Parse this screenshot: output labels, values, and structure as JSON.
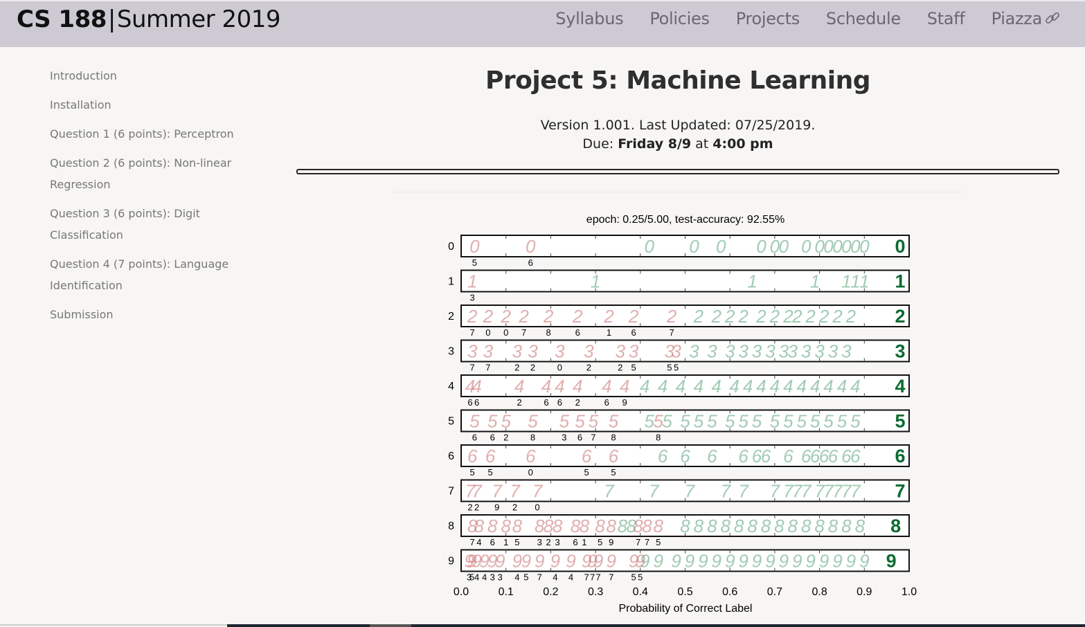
{
  "navbar": {
    "course": "CS 188",
    "separator": "|",
    "term": "Summer 2019",
    "links": [
      {
        "label": "Syllabus"
      },
      {
        "label": "Policies"
      },
      {
        "label": "Projects"
      },
      {
        "label": "Schedule"
      },
      {
        "label": "Staff"
      },
      {
        "label": "Piazza",
        "icon": "external-link-icon"
      }
    ]
  },
  "sidebar": {
    "items": [
      {
        "label": "Introduction"
      },
      {
        "label": "Installation"
      },
      {
        "label": "Question 1 (6 points): Perceptron"
      },
      {
        "label": "Question 2 (6 points): Non-linear Regression"
      },
      {
        "label": "Question 3 (6 points): Digit Classification"
      },
      {
        "label": "Question 4 (7 points): Language Identification"
      },
      {
        "label": "Submission"
      }
    ]
  },
  "page": {
    "title": "Project 5: Machine Learning",
    "version_line": "Version 1.001. Last Updated: 07/25/2019.",
    "due_prefix": "Due: ",
    "due_day": "Friday 8/9",
    "due_mid": " at ",
    "due_time": "4:00 pm"
  },
  "colors": {
    "navbar_bg": "#cdcad4",
    "page_bg": "#f7f6f4",
    "correct": "#2e8b57",
    "incorrect": "#c96b6b"
  },
  "chart_data": {
    "type": "scatter",
    "title": "epoch: 0.25/5.00, test-accuracy: 92.55%",
    "xlabel": "Probability of Correct Label",
    "ylabel": "",
    "xlim": [
      0.0,
      1.0
    ],
    "xticks": [
      "0.0",
      "0.1",
      "0.2",
      "0.3",
      "0.4",
      "0.5",
      "0.6",
      "0.7",
      "0.8",
      "0.9",
      "1.0"
    ],
    "categories": [
      "0",
      "1",
      "2",
      "3",
      "4",
      "5",
      "6",
      "7",
      "8",
      "9"
    ],
    "grid": false,
    "legend": "none",
    "series": [
      {
        "name": "0",
        "misclassified": [
          {
            "p": 0.03,
            "pred": "5"
          },
          {
            "p": 0.155,
            "pred": "6"
          }
        ],
        "correct_p": [
          0.42,
          0.52,
          0.58,
          0.67,
          0.7,
          0.72,
          0.77,
          0.8,
          0.82,
          0.84,
          0.86,
          0.88,
          0.9
        ],
        "best_p": 0.98
      },
      {
        "name": "1",
        "misclassified": [
          {
            "p": 0.025,
            "pred": "3"
          }
        ],
        "correct_p": [
          0.3,
          0.65,
          0.79,
          0.86,
          0.88,
          0.9
        ],
        "best_p": 0.98
      },
      {
        "name": "2",
        "misclassified": [
          {
            "p": 0.025,
            "pred": "7"
          },
          {
            "p": 0.06,
            "pred": "0"
          },
          {
            "p": 0.1,
            "pred": "0"
          },
          {
            "p": 0.14,
            "pred": "7"
          },
          {
            "p": 0.195,
            "pred": "8"
          },
          {
            "p": 0.26,
            "pred": "6"
          },
          {
            "p": 0.33,
            "pred": "1"
          },
          {
            "p": 0.385,
            "pred": "6"
          },
          {
            "p": 0.47,
            "pred": "7"
          }
        ],
        "correct_p": [
          0.53,
          0.57,
          0.6,
          0.63,
          0.67,
          0.7,
          0.73,
          0.75,
          0.78,
          0.81,
          0.84,
          0.87
        ],
        "best_p": 0.98
      },
      {
        "name": "3",
        "misclassified": [
          {
            "p": 0.025,
            "pred": "7"
          },
          {
            "p": 0.06,
            "pred": "7"
          },
          {
            "p": 0.125,
            "pred": "2"
          },
          {
            "p": 0.16,
            "pred": "2"
          },
          {
            "p": 0.22,
            "pred": "0"
          },
          {
            "p": 0.285,
            "pred": "2"
          },
          {
            "p": 0.355,
            "pred": "2"
          },
          {
            "p": 0.385,
            "pred": "5"
          },
          {
            "p": 0.465,
            "pred": "5"
          },
          {
            "p": 0.48,
            "pred": "5"
          }
        ],
        "correct_p": [
          0.52,
          0.56,
          0.6,
          0.63,
          0.66,
          0.69,
          0.72,
          0.74,
          0.77,
          0.8,
          0.83,
          0.86
        ],
        "best_p": 0.98
      },
      {
        "name": "4",
        "misclassified": [
          {
            "p": 0.02,
            "pred": "6"
          },
          {
            "p": 0.035,
            "pred": "6"
          },
          {
            "p": 0.13,
            "pred": "2"
          },
          {
            "p": 0.19,
            "pred": "6"
          },
          {
            "p": 0.22,
            "pred": "6"
          },
          {
            "p": 0.26,
            "pred": "2"
          },
          {
            "p": 0.325,
            "pred": "6"
          },
          {
            "p": 0.365,
            "pred": "9"
          }
        ],
        "correct_p": [
          0.41,
          0.45,
          0.49,
          0.53,
          0.57,
          0.61,
          0.64,
          0.67,
          0.7,
          0.73,
          0.76,
          0.79,
          0.82,
          0.85,
          0.88
        ],
        "best_p": 0.98
      },
      {
        "name": "5",
        "misclassified": [
          {
            "p": 0.03,
            "pred": "6"
          },
          {
            "p": 0.07,
            "pred": "6"
          },
          {
            "p": 0.1,
            "pred": "2"
          },
          {
            "p": 0.16,
            "pred": "8"
          },
          {
            "p": 0.23,
            "pred": "3"
          },
          {
            "p": 0.265,
            "pred": "6"
          },
          {
            "p": 0.295,
            "pred": "7"
          },
          {
            "p": 0.34,
            "pred": "8"
          },
          {
            "p": 0.44,
            "pred": "8"
          }
        ],
        "correct_p": [
          0.42,
          0.46,
          0.5,
          0.53,
          0.56,
          0.6,
          0.63,
          0.66,
          0.7,
          0.73,
          0.76,
          0.79,
          0.82,
          0.85,
          0.88
        ],
        "best_p": 0.98
      },
      {
        "name": "6",
        "misclassified": [
          {
            "p": 0.025,
            "pred": "5"
          },
          {
            "p": 0.065,
            "pred": "5"
          },
          {
            "p": 0.155,
            "pred": "0"
          },
          {
            "p": 0.28,
            "pred": "5"
          },
          {
            "p": 0.34,
            "pred": "5"
          }
        ],
        "correct_p": [
          0.45,
          0.5,
          0.56,
          0.63,
          0.66,
          0.68,
          0.73,
          0.77,
          0.79,
          0.81,
          0.83,
          0.86,
          0.88
        ],
        "best_p": 0.98
      },
      {
        "name": "7",
        "misclassified": [
          {
            "p": 0.02,
            "pred": "2"
          },
          {
            "p": 0.035,
            "pred": "2"
          },
          {
            "p": 0.08,
            "pred": "9"
          },
          {
            "p": 0.12,
            "pred": "2"
          },
          {
            "p": 0.17,
            "pred": "0"
          }
        ],
        "correct_p": [
          0.33,
          0.43,
          0.51,
          0.59,
          0.63,
          0.7,
          0.73,
          0.75,
          0.77,
          0.8,
          0.82,
          0.84,
          0.86,
          0.88
        ],
        "best_p": 0.98
      },
      {
        "name": "8",
        "misclassified": [
          {
            "p": 0.025,
            "pred": "7"
          },
          {
            "p": 0.04,
            "pred": "4"
          },
          {
            "p": 0.07,
            "pred": "6"
          },
          {
            "p": 0.1,
            "pred": "1"
          },
          {
            "p": 0.125,
            "pred": "5"
          },
          {
            "p": 0.175,
            "pred": "3"
          },
          {
            "p": 0.195,
            "pred": "2"
          },
          {
            "p": 0.215,
            "pred": "3"
          },
          {
            "p": 0.255,
            "pred": "6"
          },
          {
            "p": 0.275,
            "pred": "1"
          },
          {
            "p": 0.31,
            "pred": "5"
          },
          {
            "p": 0.335,
            "pred": "9"
          },
          {
            "p": 0.395,
            "pred": "7"
          },
          {
            "p": 0.415,
            "pred": "7"
          },
          {
            "p": 0.44,
            "pred": "5"
          }
        ],
        "correct_p": [
          0.36,
          0.38,
          0.5,
          0.53,
          0.56,
          0.59,
          0.62,
          0.65,
          0.68,
          0.71,
          0.74,
          0.77,
          0.8,
          0.83,
          0.86,
          0.89
        ],
        "best_p": 0.97
      },
      {
        "name": "9",
        "misclassified": [
          {
            "p": 0.018,
            "pred": "3"
          },
          {
            "p": 0.024,
            "pred": "5"
          },
          {
            "p": 0.035,
            "pred": "4"
          },
          {
            "p": 0.052,
            "pred": "4"
          },
          {
            "p": 0.07,
            "pred": "3"
          },
          {
            "p": 0.087,
            "pred": "3"
          },
          {
            "p": 0.125,
            "pred": "4"
          },
          {
            "p": 0.145,
            "pred": "5"
          },
          {
            "p": 0.175,
            "pred": "7"
          },
          {
            "p": 0.21,
            "pred": "4"
          },
          {
            "p": 0.245,
            "pred": "4"
          },
          {
            "p": 0.28,
            "pred": "7"
          },
          {
            "p": 0.293,
            "pred": "7"
          },
          {
            "p": 0.306,
            "pred": "7"
          },
          {
            "p": 0.335,
            "pred": "7"
          },
          {
            "p": 0.385,
            "pred": "5"
          },
          {
            "p": 0.4,
            "pred": "5"
          }
        ],
        "correct_p": [
          0.41,
          0.44,
          0.48,
          0.51,
          0.54,
          0.57,
          0.6,
          0.63,
          0.66,
          0.69,
          0.72,
          0.75,
          0.78,
          0.81,
          0.84,
          0.87,
          0.9
        ],
        "best_p": 0.96
      }
    ]
  }
}
